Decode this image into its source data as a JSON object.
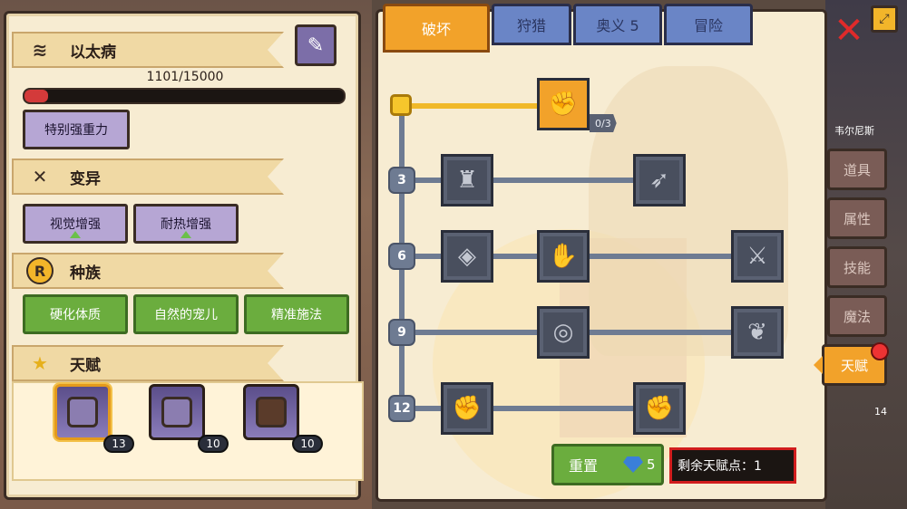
{
  "left": {
    "disease": {
      "label": "以太病"
    },
    "progress": {
      "text": "1101/15000",
      "fraction": 0.0734
    },
    "disease_tag": "特别强重力",
    "mutation": {
      "label": "变异",
      "tags": [
        "视觉增强",
        "耐热增强"
      ]
    },
    "race": {
      "label": "种族",
      "tags": [
        "硬化体质",
        "自然的宠儿",
        "精准施法"
      ]
    },
    "talent": {
      "label": "天赋"
    },
    "characters": [
      {
        "level": "13",
        "selected": true
      },
      {
        "level": "10",
        "selected": false
      },
      {
        "level": "10",
        "selected": false
      }
    ]
  },
  "tabs": [
    "破坏",
    "狩猎",
    "奥义 5",
    "冒险"
  ],
  "tree": {
    "root_counter": "0/3",
    "levels": [
      "3",
      "6",
      "9",
      "12"
    ]
  },
  "bottom": {
    "reset_label": "重置",
    "reset_cost": "5",
    "remaining_points": "剩余天赋点：1"
  },
  "side_nav": {
    "npc_name": "韦尔尼斯",
    "items": [
      "道具",
      "属性",
      "技能",
      "魔法",
      "天赋"
    ],
    "active": "天赋",
    "count": "14"
  },
  "colors": {
    "accent": "#f2a22a",
    "progress_fill": "#d33a3a",
    "green_button": "#6bad3e",
    "purple_tag": "#b6a6d4",
    "tab_blue": "#6a85c6"
  }
}
